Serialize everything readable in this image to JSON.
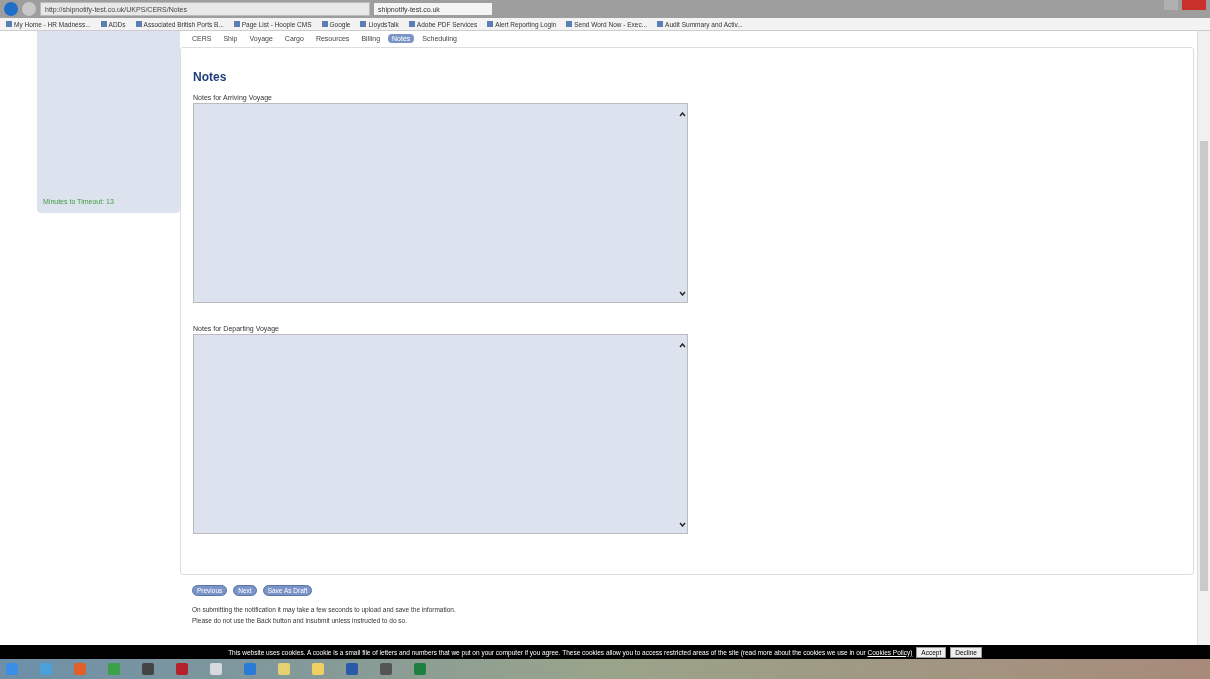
{
  "browser": {
    "address": "http://shipnotify-test.co.uk/UKPS/CERS/Notes",
    "tab_title": "shipnotify-test.co.uk"
  },
  "bookmarks": [
    "My Home - HR Madness...",
    "ADDs",
    "Associated British Ports B...",
    "Page List - Hoople CMS",
    "Google",
    "LloydsTalk",
    "Adobe PDF Services",
    "Alert Reporting Login",
    "Send Word Now - Exec...",
    "Audit Summary and Activ..."
  ],
  "sidebar": {
    "timeout": "Minutes to Timeout: 13"
  },
  "tabs": [
    {
      "label": "CERS",
      "selected": false
    },
    {
      "label": "Ship",
      "selected": false
    },
    {
      "label": "Voyage",
      "selected": false
    },
    {
      "label": "Cargo",
      "selected": false
    },
    {
      "label": "Resources",
      "selected": false
    },
    {
      "label": "Billing",
      "selected": false
    },
    {
      "label": "Notes",
      "selected": true
    },
    {
      "label": "Scheduling",
      "selected": false
    }
  ],
  "heading": "Notes",
  "fields": [
    {
      "label": "Notes for Arriving Voyage"
    },
    {
      "label": "Notes for Departing Voyage"
    }
  ],
  "buttons": [
    "Previous",
    "Next",
    "Save As Draft"
  ],
  "messages": [
    "On submitting the notification it may take a few seconds to upload and save the information.",
    "Please do not use the Back button and insubmit unless instructed to do so."
  ],
  "cookie_banner": {
    "text": "This website uses cookies. A cookie is a small file of letters and numbers that we put on your computer if you agree. These cookies allow you to access restricted areas of the site (read more about the cookies we use in our",
    "link": "Cookies Policy)",
    "buttons": [
      "Accept",
      "Decline"
    ]
  }
}
